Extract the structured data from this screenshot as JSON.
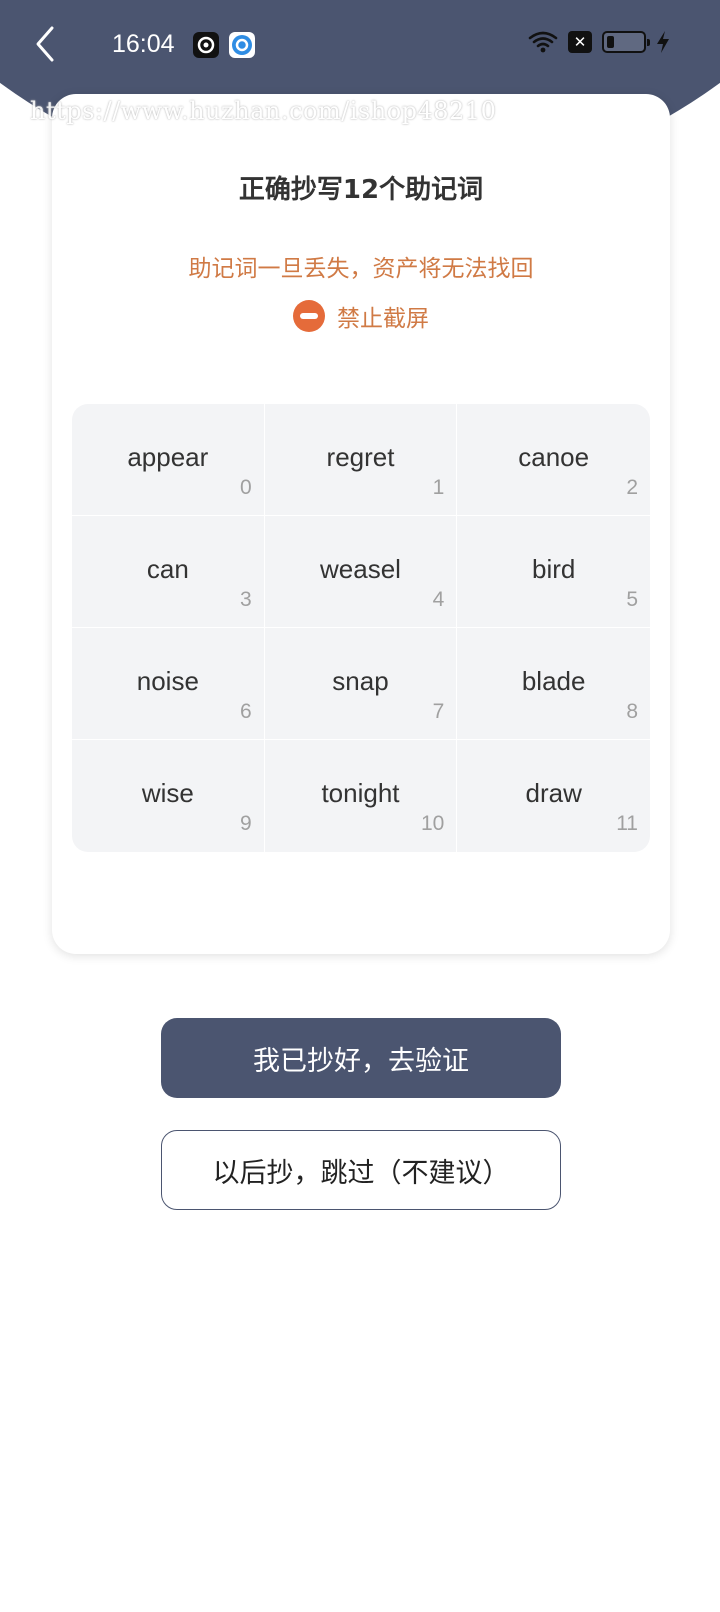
{
  "status_bar": {
    "time": "16:04"
  },
  "watermark": "https://www.huzhan.com/ishop48210",
  "card": {
    "title": "正确抄写12个助记词",
    "warning": "助记词一旦丢失，资产将无法找回",
    "no_screenshot_label": "禁止截屏"
  },
  "words": [
    {
      "word": "appear",
      "index": "0"
    },
    {
      "word": "regret",
      "index": "1"
    },
    {
      "word": "canoe",
      "index": "2"
    },
    {
      "word": "can",
      "index": "3"
    },
    {
      "word": "weasel",
      "index": "4"
    },
    {
      "word": "bird",
      "index": "5"
    },
    {
      "word": "noise",
      "index": "6"
    },
    {
      "word": "snap",
      "index": "7"
    },
    {
      "word": "blade",
      "index": "8"
    },
    {
      "word": "wise",
      "index": "9"
    },
    {
      "word": "tonight",
      "index": "10"
    },
    {
      "word": "draw",
      "index": "11"
    }
  ],
  "actions": {
    "confirm_label": "我已抄好，去验证",
    "skip_label": "以后抄，跳过（不建议）"
  },
  "icons": {
    "back": "chevron-left-icon",
    "stop": "stop-icon",
    "wifi": "wifi-icon",
    "battery": "battery-icon",
    "charging": "bolt-icon"
  },
  "battery_level": 0.2,
  "colors": {
    "header": "#4b5570",
    "accent": "#d07a45",
    "stop": "#e56b3a",
    "primary_button": "#4b5570",
    "grid_bg": "#f3f4f6"
  }
}
